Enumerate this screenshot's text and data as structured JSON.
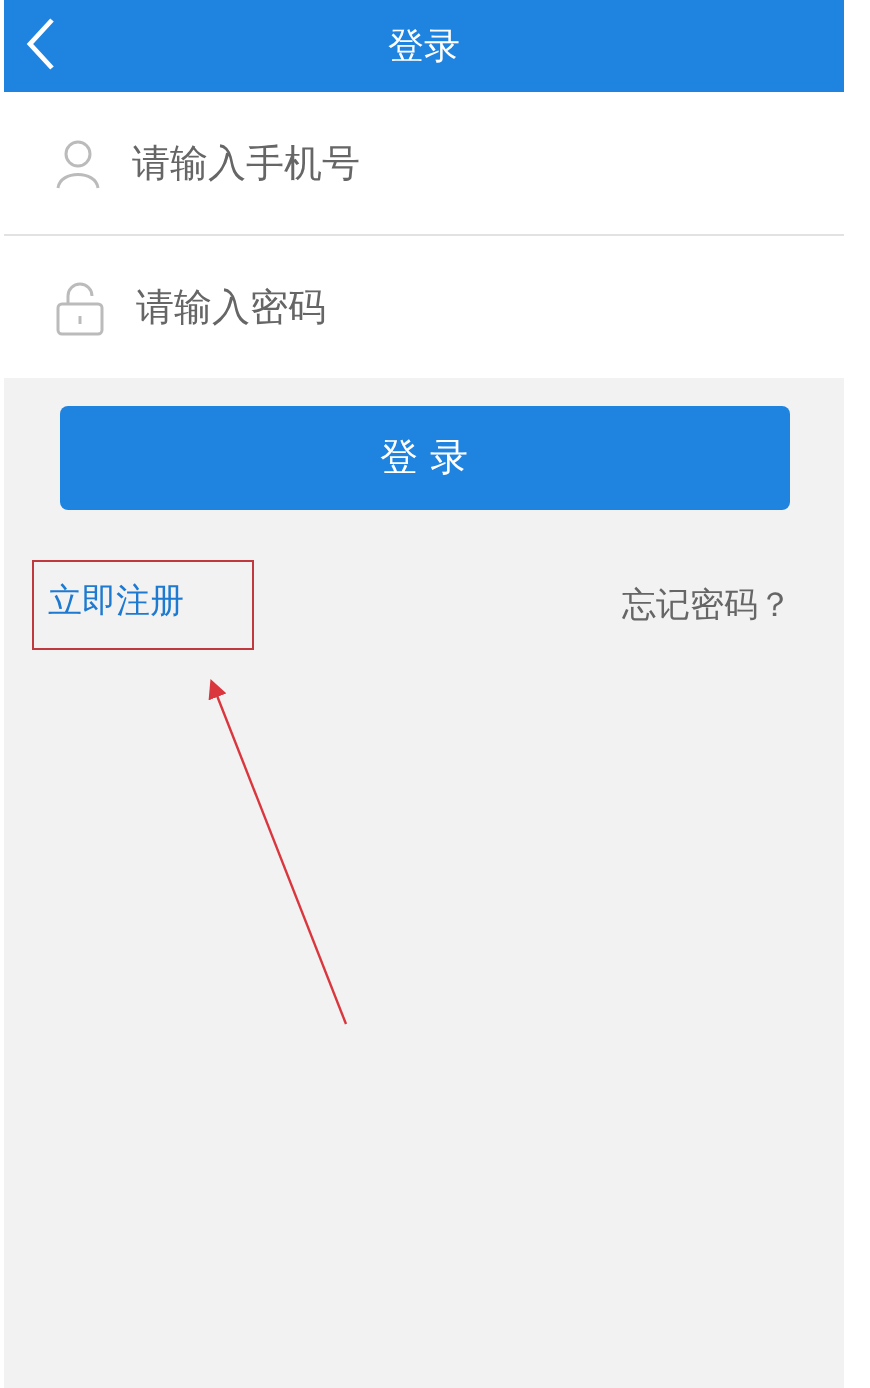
{
  "header": {
    "title": "登录"
  },
  "fields": [
    {
      "kind": "phone",
      "placeholder": "请输入手机号"
    },
    {
      "kind": "password",
      "placeholder": "请输入密码"
    }
  ],
  "login_button": "登 录",
  "links": {
    "register": {
      "label": "立即注册",
      "annotated": true
    },
    "forgot": {
      "label": "忘记密码？"
    }
  }
}
